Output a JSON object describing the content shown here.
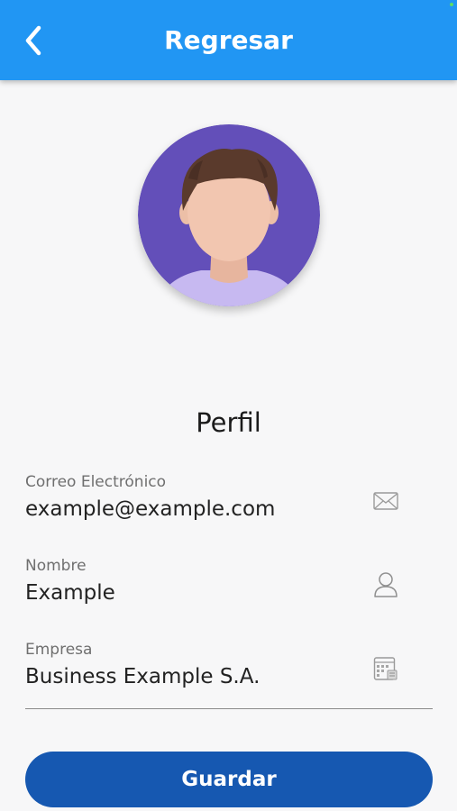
{
  "app_bar": {
    "title": "Regresar",
    "back_icon": "chevron-left-icon",
    "background_color": "#2196f3",
    "text_color": "#ffffff"
  },
  "profile": {
    "avatar_icon": "user-avatar-illustration",
    "section_title": "Perfil"
  },
  "fields": [
    {
      "label": "Correo Electrónico",
      "value": "example@example.com",
      "icon": "mail-icon"
    },
    {
      "label": "Nombre",
      "value": "Example",
      "icon": "user-icon"
    },
    {
      "label": "Empresa",
      "value": "Business Example S.A.",
      "icon": "business-icon"
    }
  ],
  "actions": {
    "save_label": "Guardar",
    "save_color": "#1658b1"
  }
}
